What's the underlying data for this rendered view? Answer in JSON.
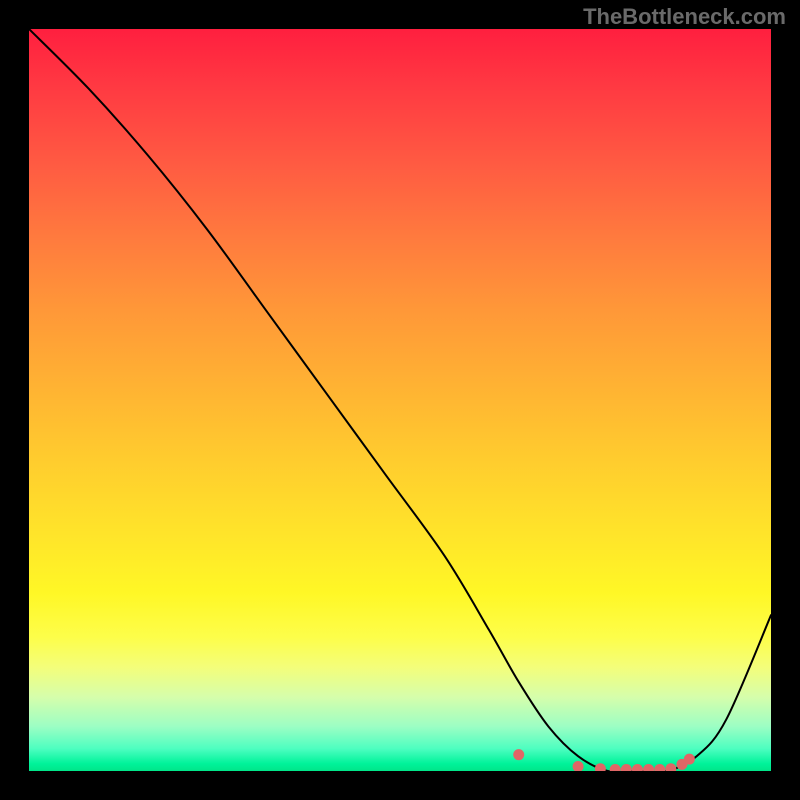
{
  "watermark": "TheBottleneck.com",
  "chart_data": {
    "type": "line",
    "title": "",
    "xlabel": "",
    "ylabel": "",
    "xlim": [
      0,
      100
    ],
    "ylim": [
      0,
      100
    ],
    "series": [
      {
        "name": "curve",
        "x": [
          0,
          8,
          16,
          24,
          32,
          40,
          48,
          56,
          62,
          66,
          70,
          74,
          78,
          82,
          86,
          90,
          94,
          100
        ],
        "values": [
          100,
          92,
          83,
          73,
          62,
          51,
          40,
          29,
          19,
          12,
          6,
          2,
          0,
          0,
          0,
          2,
          7,
          21
        ]
      }
    ],
    "markers": {
      "name": "dots",
      "x": [
        66,
        74,
        77,
        79,
        80.5,
        82,
        83.5,
        85,
        86.5,
        88,
        89
      ],
      "values": [
        2.2,
        0.6,
        0.3,
        0.2,
        0.2,
        0.2,
        0.2,
        0.2,
        0.3,
        0.9,
        1.6
      ]
    },
    "note": "Axes are unitless (percent-like, 0–100). Curve starts at top-left, descends to a flat minimum around x≈74–86, then rises toward the right edge. Marker dots cluster near the minimum."
  }
}
